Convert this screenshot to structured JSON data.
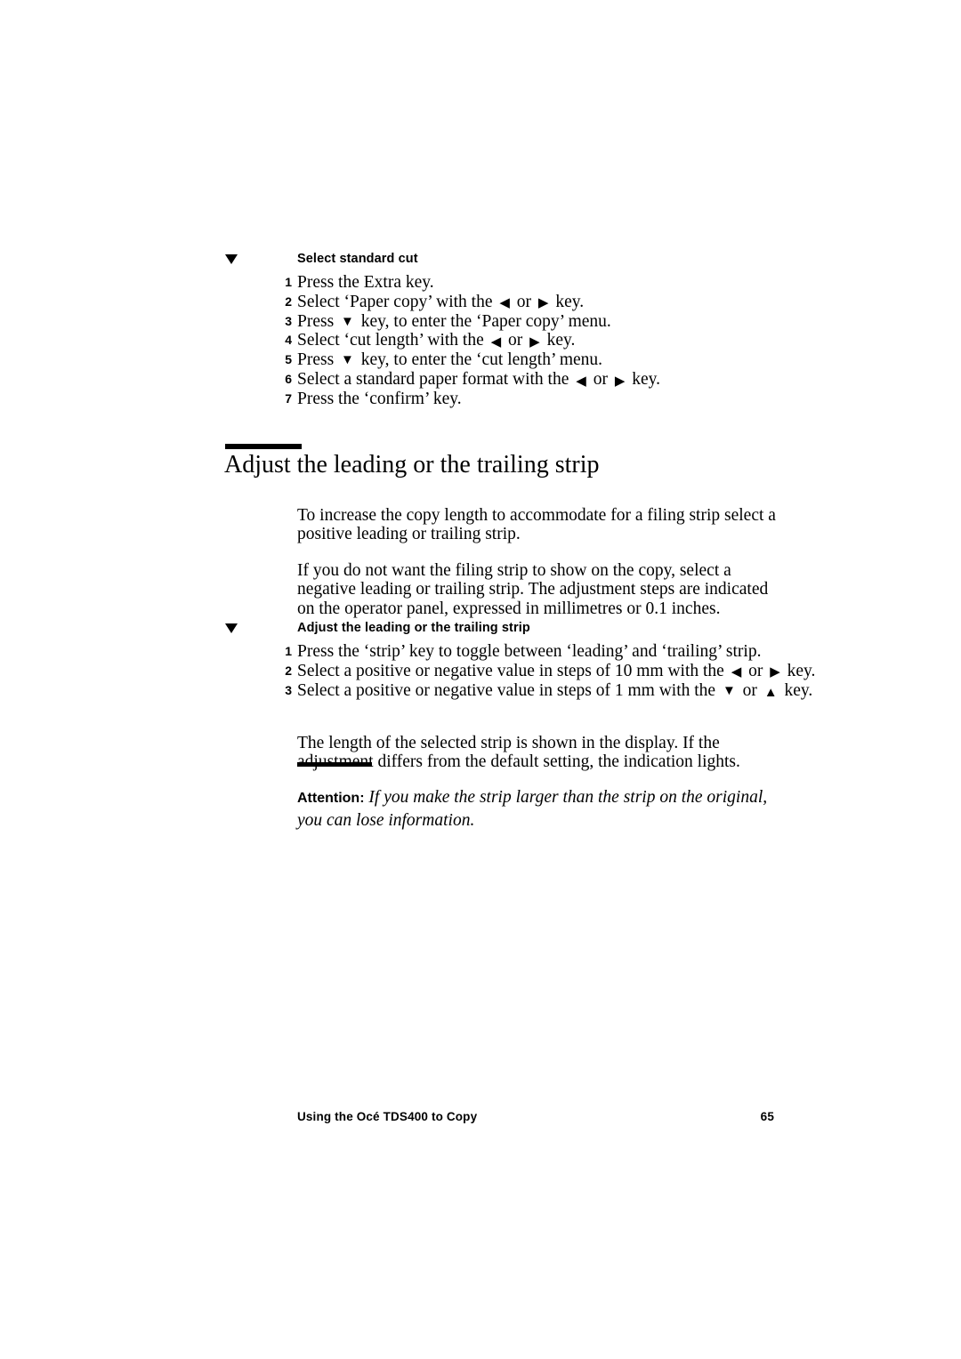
{
  "page": {
    "background": "#ffffff",
    "text_color": "#000000"
  },
  "procedure_1": {
    "marker": "down-triangle",
    "title": "Select standard cut",
    "steps": [
      {
        "num": "1",
        "before": "Press the Extra key.",
        "arrow1": "",
        "mid": "",
        "arrow2": "",
        "after": ""
      },
      {
        "num": "2",
        "before": "Select ‘Paper copy’ with the ",
        "arrow1": "◀",
        "mid": " or ",
        "arrow2": "▶",
        "after": " key."
      },
      {
        "num": "3",
        "before": "Press ",
        "arrow1": "▼",
        "mid": "",
        "arrow2": "",
        "after": " key, to enter the ‘Paper copy’ menu."
      },
      {
        "num": "4",
        "before": "Select ‘cut length’ with the ",
        "arrow1": "◀",
        "mid": " or ",
        "arrow2": "▶",
        "after": " key."
      },
      {
        "num": "5",
        "before": "Press ",
        "arrow1": "▼",
        "mid": "",
        "arrow2": "",
        "after": " key, to enter the ‘cut length’ menu."
      },
      {
        "num": "6",
        "before": "Select a standard paper format with the ",
        "arrow1": "◀",
        "mid": " or ",
        "arrow2": "▶",
        "after": " key."
      },
      {
        "num": "7",
        "before": "Press the ‘confirm’ key.",
        "arrow1": "",
        "mid": "",
        "arrow2": "",
        "after": ""
      }
    ]
  },
  "chapter": {
    "title": "Adjust the leading or the trailing strip",
    "rule": true
  },
  "paragraphs": {
    "p1": "To increase the copy length to accommodate for a filing strip select a positive leading or trailing strip.",
    "p2": "If you do not want the filing strip to show on the copy, select a negative leading or trailing strip. The adjustment steps are indicated on the operator panel, expressed in millimetres or 0.1 inches.",
    "p3": "The length of the selected strip is shown in the display. If the adjustment differs from the default setting, the indication lights."
  },
  "procedure_2": {
    "marker": "down-triangle",
    "title": "Adjust the leading or the trailing strip",
    "steps": [
      {
        "num": "1",
        "before": "Press the ‘strip’ key to toggle between ‘leading’ and ‘trailing’ strip.",
        "arrow1": "",
        "mid": "",
        "arrow2": "",
        "after": ""
      },
      {
        "num": "2",
        "before": "Select a positive or negative value in steps of 10 mm with the ",
        "arrow1": "◀",
        "mid": " or ",
        "arrow2": "▶",
        "after": " key."
      },
      {
        "num": "3",
        "before": "Select a positive or negative value in steps of 1 mm with the ",
        "arrow1": "▼",
        "mid": " or ",
        "arrow2": "▲",
        "after": " key."
      }
    ]
  },
  "attention": {
    "label": "Attention:",
    "text": " If you make the strip larger than the strip on the original, you can lose information."
  },
  "footer": {
    "left": "Using the Océ TDS400 to Copy",
    "page_number": "65"
  }
}
